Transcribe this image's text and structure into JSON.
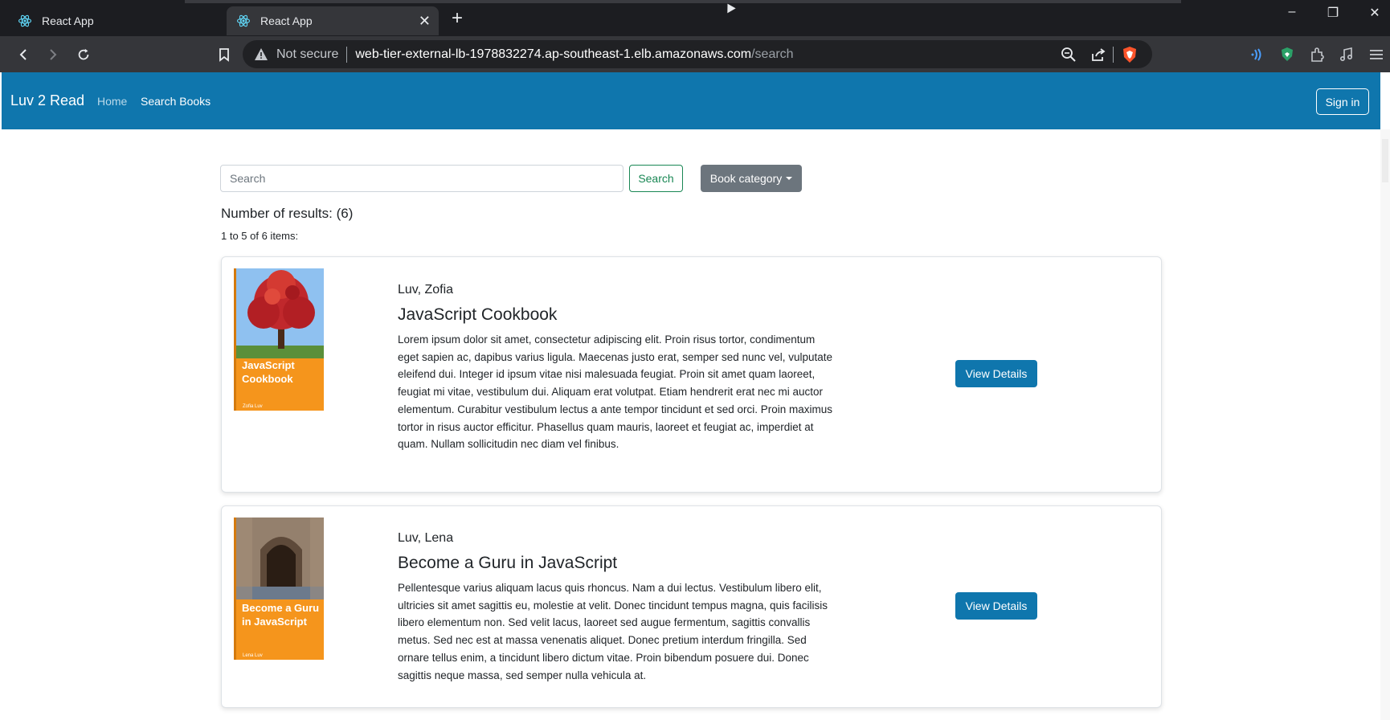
{
  "browser": {
    "tabs": [
      {
        "title": "React App",
        "active": false
      },
      {
        "title": "React App",
        "active": true
      }
    ],
    "new_tab": "+",
    "window_controls": {
      "minimize": "–",
      "restore": "❐",
      "close": "✕"
    },
    "address": {
      "security_label": "Not secure",
      "host": "web-tier-external-lb-1978832274.ap-southeast-1.elb.amazonaws.com",
      "path": "/search"
    },
    "icons": [
      "back-icon",
      "forward-icon",
      "reload-icon",
      "bookmark-icon",
      "warning-icon",
      "zoom-out-icon",
      "share-icon",
      "brave-shield-icon",
      "wallet-icon",
      "shield-extension-icon",
      "extensions-icon",
      "media-icon",
      "menu-icon"
    ],
    "colors": {
      "brave_orange": "#fb542b",
      "wifi_blue": "#4a9eff",
      "extension_green": "#2ba168"
    }
  },
  "navbar": {
    "brand": "Luv 2 Read",
    "links": [
      {
        "label": "Home",
        "active": false
      },
      {
        "label": "Search Books",
        "active": true
      }
    ],
    "sign_in": "Sign in",
    "color": "#0f76ad"
  },
  "search": {
    "placeholder": "Search",
    "button_label": "Search",
    "category_label": "Book category"
  },
  "results": {
    "count_label": "Number of results: (6)",
    "range_label": "1 to 5 of 6 items:"
  },
  "books": [
    {
      "author": "Luv, Zofia",
      "title": "JavaScript Cookbook",
      "cover_title": "JavaScript Cookbook",
      "cover_author": "Zofia Luv",
      "description": "Lorem ipsum dolor sit amet, consectetur adipiscing elit. Proin risus tortor, condimentum eget sapien ac, dapibus varius ligula. Maecenas justo erat, semper sed nunc vel, vulputate eleifend dui. Integer id ipsum vitae nisi malesuada feugiat. Proin sit amet quam laoreet, feugiat mi vitae, vestibulum dui. Aliquam erat volutpat. Etiam hendrerit erat nec mi auctor elementum. Curabitur vestibulum lectus a ante tempor tincidunt et sed orci. Proin maximus tortor in risus auctor efficitur. Phasellus quam mauris, laoreet et feugiat ac, imperdiet at quam. Nullam sollicitudin nec diam vel finibus.",
      "button_label": "View Details"
    },
    {
      "author": "Luv, Lena",
      "title": "Become a Guru in JavaScript",
      "cover_title": "Become a Guru in JavaScript",
      "cover_author": "Lena Luv",
      "description": "Pellentesque varius aliquam lacus quis rhoncus. Nam a dui lectus. Vestibulum libero elit, ultricies sit amet sagittis eu, molestie at velit. Donec tincidunt tempus magna, quis facilisis libero elementum non. Sed velit lacus, laoreet sed augue fermentum, sagittis convallis metus. Sed nec est at massa venenatis aliquet. Donec pretium interdum fringilla. Sed ornare tellus enim, a tincidunt libero dictum vitae. Proin bibendum posuere dui. Donec sagittis neque massa, sed semper nulla vehicula at.",
      "button_label": "View Details"
    }
  ]
}
